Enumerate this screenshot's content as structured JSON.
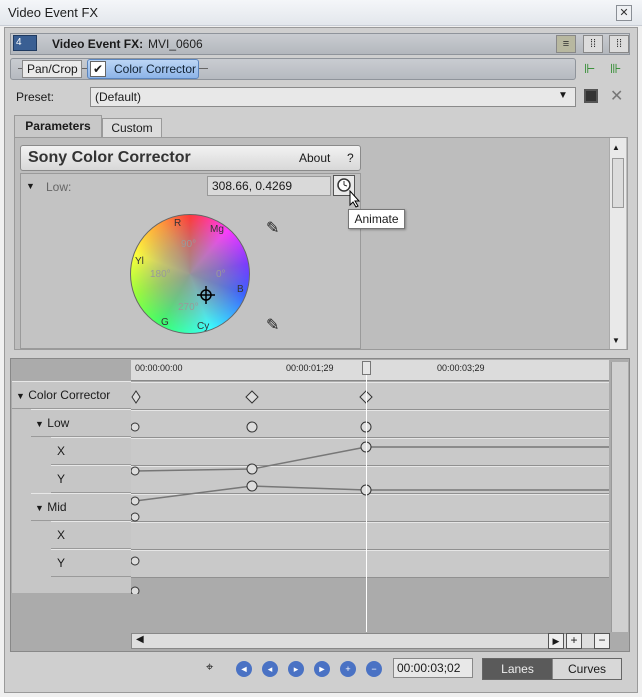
{
  "window": {
    "title": "Video Event FX",
    "close": "✕"
  },
  "header": {
    "event_number": "4",
    "label": "Video Event FX:",
    "event_name": "MVI_0606"
  },
  "chain": {
    "items": [
      "Pan/Crop",
      "Color Corrector"
    ]
  },
  "preset": {
    "label": "Preset:",
    "value": "(Default)"
  },
  "tabs": [
    "Parameters",
    "Custom"
  ],
  "plugin": {
    "name": "Sony Color Corrector",
    "about": "About",
    "help": "?",
    "section": "Low:",
    "value": "308.66, 0.4269",
    "tooltip": "Animate",
    "wheel_labels": {
      "R": "R",
      "Mg": "Mg",
      "Yl": "Yl",
      "B": "B",
      "G": "G",
      "Cy": "Cy"
    },
    "wheel_degrees": {
      "d90": "90°",
      "d180": "180°",
      "d0": "0°",
      "d270": "270°"
    }
  },
  "timeline": {
    "ticks": [
      "00:00:00:00",
      "00:00:01;29",
      "00:00:03;29"
    ],
    "lanes": [
      {
        "name": "Color Corrector",
        "level": 0,
        "expand": true
      },
      {
        "name": "Low",
        "level": 1,
        "expand": true
      },
      {
        "name": "X",
        "level": 2,
        "expand": false
      },
      {
        "name": "Y",
        "level": 2,
        "expand": false
      },
      {
        "name": "Mid",
        "level": 1,
        "expand": true
      },
      {
        "name": "X",
        "level": 2,
        "expand": false
      },
      {
        "name": "Y",
        "level": 2,
        "expand": false
      }
    ]
  },
  "bottom": {
    "time": "00:00:03;02",
    "lanes": "Lanes",
    "curves": "Curves"
  },
  "colors": {
    "accent": "#4a72c4",
    "selected_chip": "#8db4e8"
  }
}
